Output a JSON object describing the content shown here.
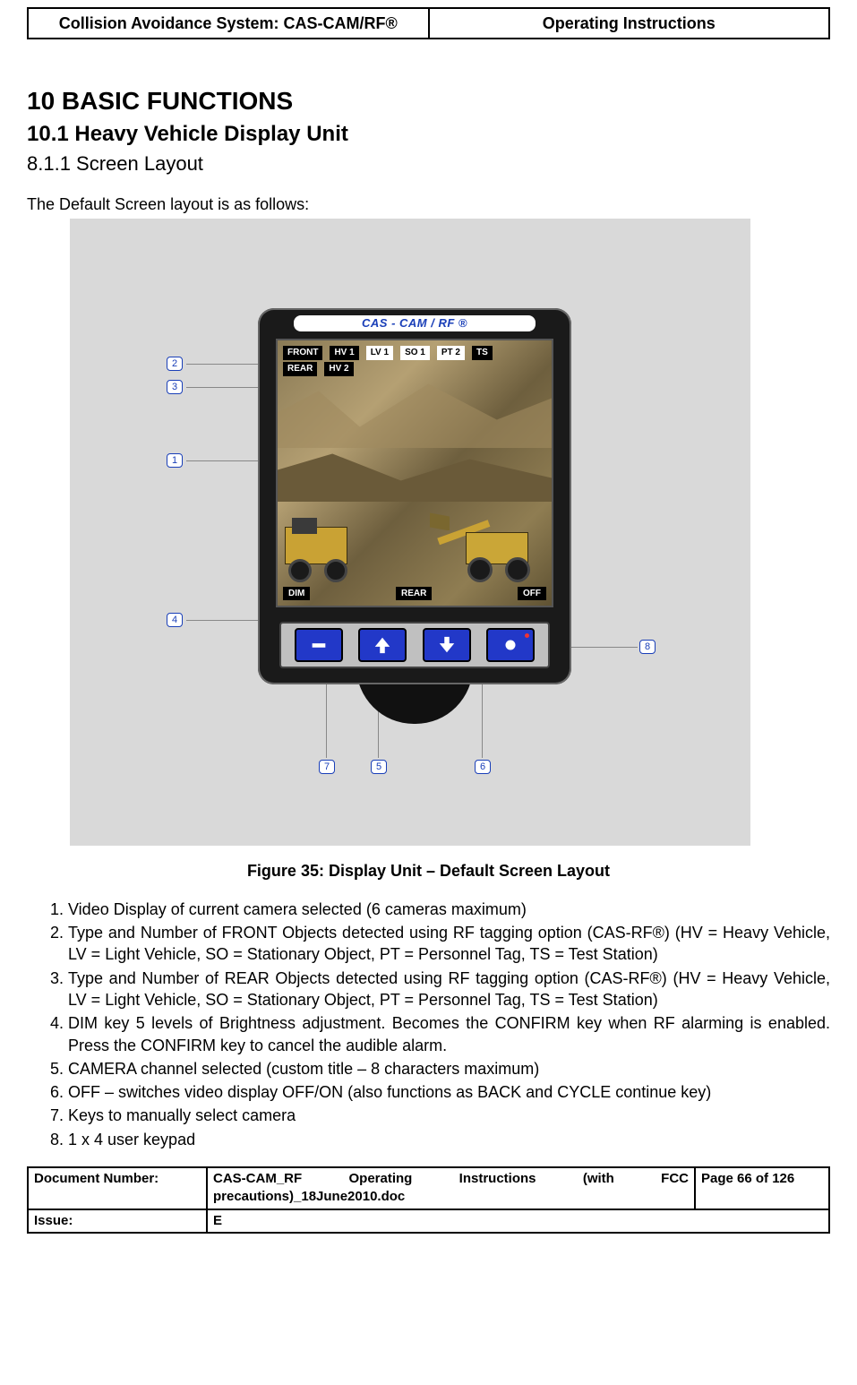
{
  "header": {
    "left": "Collision Avoidance System: CAS-CAM/RF®",
    "right": "Operating Instructions"
  },
  "headings": {
    "chapter": "10  BASIC FUNCTIONS",
    "section": "10.1 Heavy Vehicle Display Unit",
    "subsection": "8.1.1 Screen Layout"
  },
  "intro": "The Default Screen layout is as follows:",
  "device": {
    "title": "CAS - CAM / RF ®",
    "osd_front": [
      "FRONT",
      "HV 1",
      "LV 1",
      "SO 1",
      "PT 2",
      "TS"
    ],
    "osd_rear": [
      "REAR",
      "HV 2"
    ],
    "osd_bottom_left": "DIM",
    "osd_bottom_mid": "REAR",
    "osd_bottom_right": "OFF"
  },
  "callouts": {
    "c1": "1",
    "c2": "2",
    "c3": "3",
    "c4": "4",
    "c5": "5",
    "c6": "6",
    "c7": "7",
    "c8": "8"
  },
  "figure_caption": "Figure 35:  Display Unit – Default Screen Layout",
  "legend": [
    "Video Display of current camera selected (6 cameras maximum)",
    "Type and Number of FRONT Objects detected using RF tagging option (CAS-RF®) (HV = Heavy Vehicle, LV = Light Vehicle, SO = Stationary Object, PT = Personnel Tag, TS = Test Station)",
    "Type and Number of REAR Objects detected using RF tagging option (CAS-RF®)  (HV = Heavy Vehicle, LV = Light Vehicle, SO = Stationary Object, PT = Personnel Tag, TS = Test Station)",
    "DIM key 5 levels of Brightness adjustment. Becomes the CONFIRM key when RF alarming is enabled. Press the CONFIRM key to cancel the audible alarm.",
    "CAMERA channel selected (custom title – 8 characters maximum)",
    "OFF – switches video display OFF/ON (also functions as BACK and CYCLE continue key)",
    "Keys to manually select camera",
    "1 x 4 user keypad"
  ],
  "footer": {
    "docnum_label": "Document Number:",
    "docnum_value": "CAS-CAM_RF Operating Instructions (with FCC precautions)_18June2010.doc",
    "page": "Page 66 of  126",
    "issue_label": "Issue:",
    "issue_value": "E"
  }
}
